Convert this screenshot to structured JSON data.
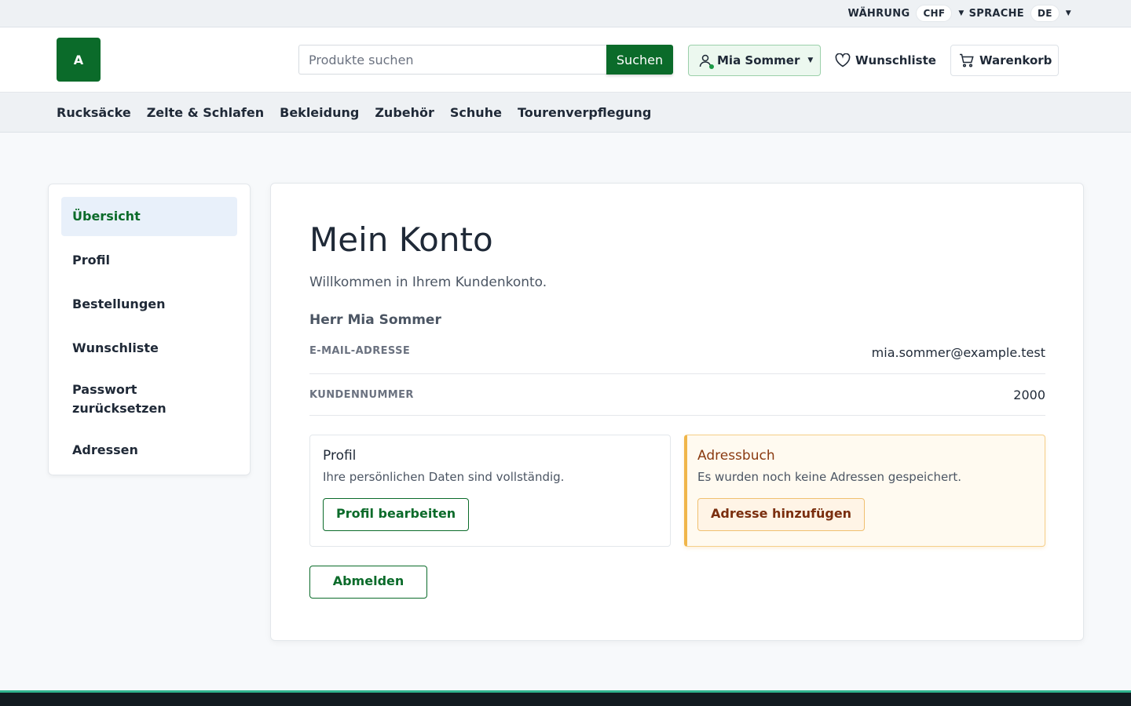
{
  "topbar": {
    "currency_label": "WÄHRUNG",
    "currency_value": "CHF",
    "language_label": "SPRACHE",
    "language_value": "DE"
  },
  "header": {
    "logo_text": "A",
    "search_placeholder": "Produkte suchen",
    "search_button": "Suchen",
    "account_name": "Mia Sommer",
    "wishlist_label": "Wunschliste",
    "cart_label": "Warenkorb"
  },
  "categories": [
    "Rucksäcke",
    "Zelte & Schlafen",
    "Bekleidung",
    "Zubehör",
    "Schuhe",
    "Tourenverpflegung"
  ],
  "sidebar": {
    "items": [
      {
        "label": "Übersicht",
        "active": true
      },
      {
        "label": "Profil"
      },
      {
        "label": "Bestellungen"
      },
      {
        "label": "Wunschliste"
      },
      {
        "label": "Passwort zurücksetzen"
      },
      {
        "label": "Adressen"
      }
    ]
  },
  "main": {
    "title": "Mein Konto",
    "welcome": "Willkommen in Ihrem Kundenkonto.",
    "person": "Herr Mia Sommer",
    "email_label": "E-MAIL-ADRESSE",
    "email_value": "mia.sommer@example.test",
    "customer_label": "KUNDENNUMMER",
    "customer_value": "2000",
    "profile_card": {
      "title": "Profil",
      "text": "Ihre persönlichen Daten sind vollständig.",
      "button": "Profil bearbeiten"
    },
    "address_card": {
      "title": "Adressbuch",
      "text": "Es wurden noch keine Adressen gespeichert.",
      "button": "Adresse hinzufügen"
    },
    "logout": "Abmelden"
  },
  "colors": {
    "brand": "#0b6b2a",
    "warn_border": "#f0b64a",
    "active_bg": "#e8f0fa"
  }
}
